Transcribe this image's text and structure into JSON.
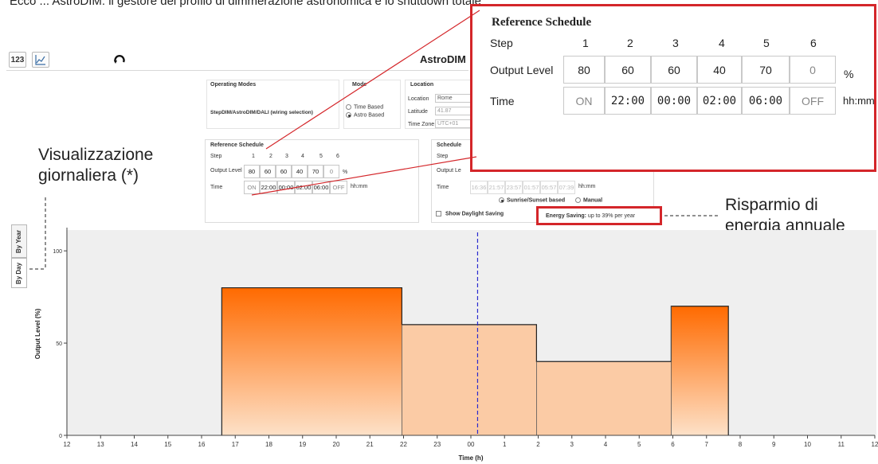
{
  "top_caption": "Ecco ... AstroDIM: il gestore del profilo di dimmerazione astronomica e lo shutdown totale",
  "toolbar": {
    "numeric_label": "123",
    "chart_icon": "chart-icon",
    "refresh_icon": "refresh-icon",
    "app_title": "AstroDIM"
  },
  "operating_modes": {
    "title": "Operating Modes",
    "value": "StepDIM/AstroDIM/DALI (wiring selection)"
  },
  "mode": {
    "title": "Mode",
    "options": [
      "Time Based",
      "Astro Based"
    ],
    "selected": "Astro Based"
  },
  "location": {
    "title": "Location",
    "location_label": "Location",
    "location_value": "Rome",
    "latitude_label": "Latitude",
    "latitude_value": "41.87",
    "timezone_label": "Time Zone",
    "timezone_value": "UTC+01"
  },
  "reference_schedule": {
    "title": "Reference Schedule",
    "step_label": "Step",
    "output_label": "Output Level",
    "time_label": "Time",
    "steps": [
      "1",
      "2",
      "3",
      "4",
      "5",
      "6"
    ],
    "levels": [
      "80",
      "60",
      "60",
      "40",
      "70",
      "0"
    ],
    "times": [
      "ON",
      "22:00",
      "00:00",
      "02:00",
      "06:00",
      "OFF"
    ],
    "level_unit": "%",
    "time_unit": "hh:mm"
  },
  "schedule": {
    "title": "Schedule",
    "step_label": "Step",
    "output_label": "Output Le",
    "time_label": "Time",
    "times": [
      "16:36",
      "21:57",
      "23:57",
      "01:57",
      "05:57",
      "07:39"
    ],
    "time_unit": "hh:mm",
    "options": [
      "Sunrise/Sunset based",
      "Manual"
    ],
    "selected": "Sunrise/Sunset based"
  },
  "daylight": {
    "label": "Show Daylight Saving",
    "checked": false
  },
  "energy_saving": {
    "label": "Energy Saving:",
    "value": "up to 39% per year"
  },
  "annotations": {
    "daily_view": "Visualizzazione\ngiornaliera (*)",
    "annual_saving": "Risparmio di\nenergia annuale"
  },
  "side_tabs": [
    "By Day",
    "By Year"
  ],
  "colors": {
    "callout_red": "#d4262a",
    "bar_orange_dark": "#ff6a00",
    "bar_orange_light": "#fde1c8",
    "current_time_line": "#2a2ad0"
  },
  "chart_data": {
    "type": "area",
    "xlabel": "Time (h)",
    "ylabel": "Output Level (%)",
    "y_ticks": [
      0,
      50,
      100
    ],
    "ylim": [
      0,
      110
    ],
    "x_ticks": [
      "12",
      "13",
      "14",
      "15",
      "16",
      "17",
      "18",
      "19",
      "20",
      "21",
      "22",
      "23",
      "00",
      "1",
      "2",
      "3",
      "4",
      "5",
      "6",
      "7",
      "8",
      "9",
      "10",
      "11",
      "12"
    ],
    "x_start_hour": 12,
    "x_span_hours": 24,
    "steps": [
      {
        "from": "16:36",
        "to": "21:57",
        "level": 80
      },
      {
        "from": "21:57",
        "to": "01:57",
        "level": 60
      },
      {
        "from": "01:57",
        "to": "05:57",
        "level": 40
      },
      {
        "from": "05:57",
        "to": "07:39",
        "level": 70
      }
    ],
    "current_time": "00:12",
    "grid": false
  }
}
